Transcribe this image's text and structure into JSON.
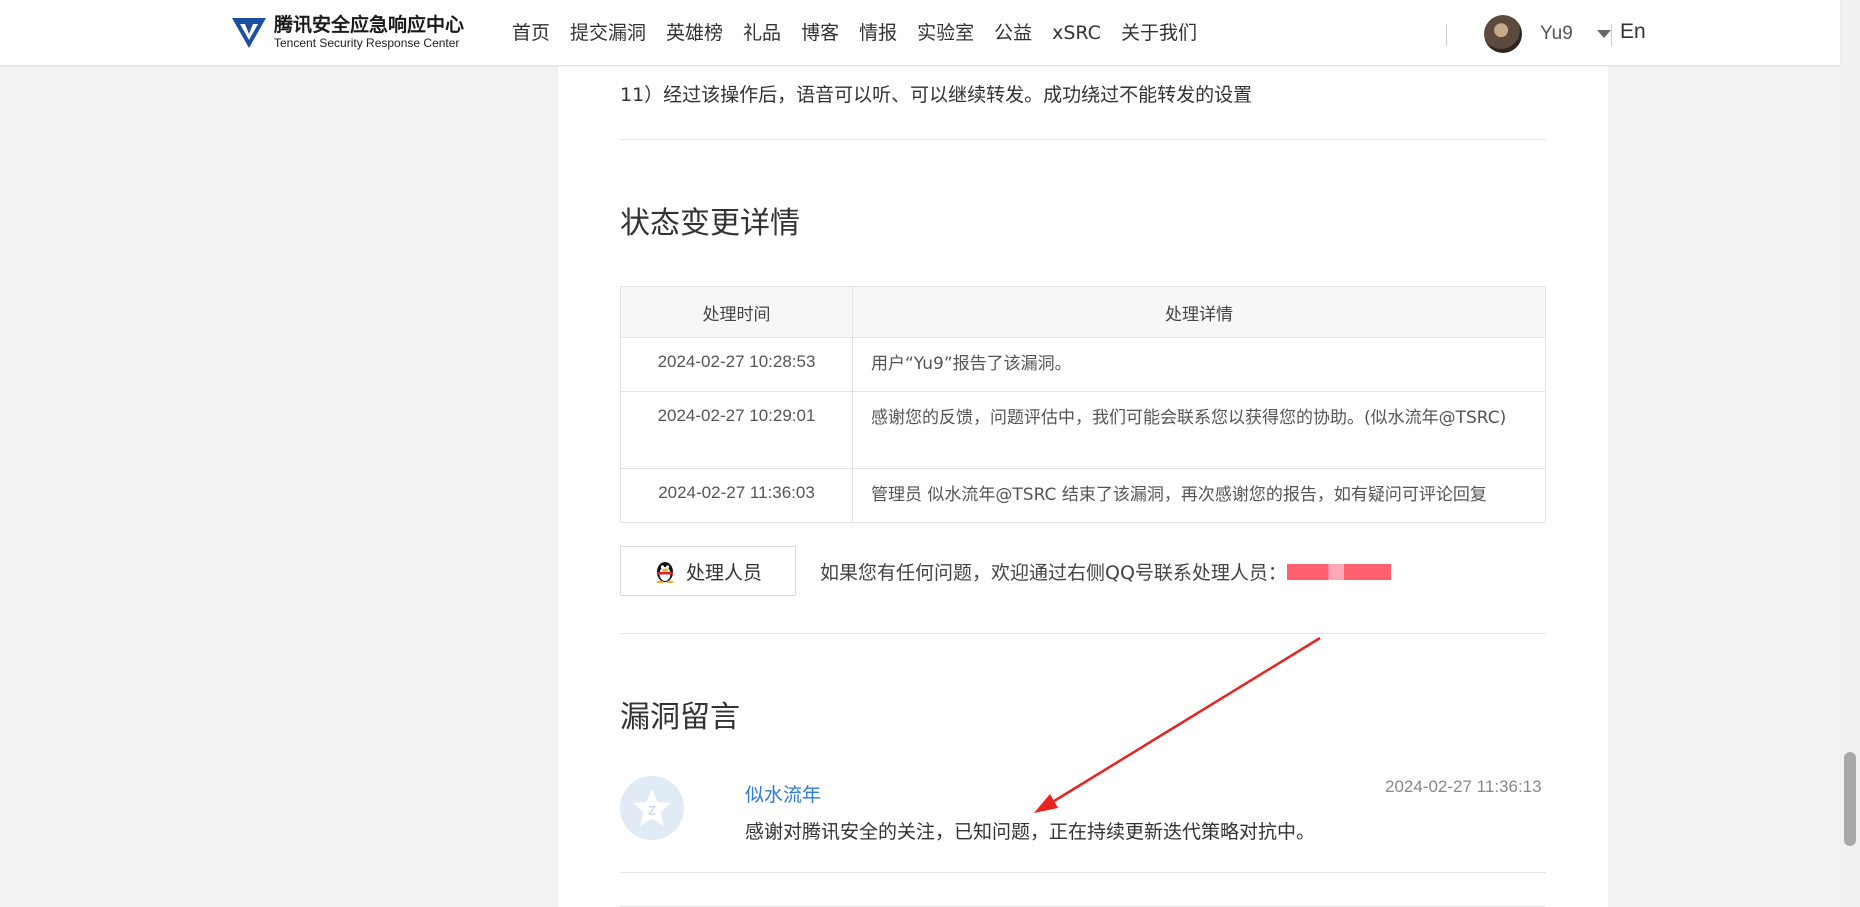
{
  "header": {
    "logo_cn": "腾讯安全应急响应中心",
    "logo_en": "Tencent Security Response Center",
    "nav": [
      "首页",
      "提交漏洞",
      "英雄榜",
      "礼品",
      "博客",
      "情报",
      "实验室",
      "公益",
      "xSRC",
      "关于我们"
    ],
    "user_name": "Yu9",
    "lang": "En"
  },
  "content": {
    "intro": "11）经过该操作后，语音可以听、可以继续转发。成功绕过不能转发的设置",
    "status_title": "状态变更详情",
    "table": {
      "headers": [
        "处理时间",
        "处理详情"
      ],
      "rows": [
        {
          "time": "2024-02-27 10:28:53",
          "detail": "用户“Yu9”报告了该漏洞。"
        },
        {
          "time": "2024-02-27 10:29:01",
          "detail": "感谢您的反馈，问题评估中，我们可能会联系您以获得您的协助。(似水流年@TSRC)"
        },
        {
          "time": "2024-02-27 11:36:03",
          "detail": "管理员 似水流年@TSRC 结束了该漏洞，再次感谢您的报告，如有疑问可评论回复"
        }
      ]
    },
    "handler_button": "处理人员",
    "contact_text": "如果您有任何问题，欢迎通过右侧QQ号联系处理人员：",
    "comments_title": "漏洞留言",
    "comment": {
      "author": "似水流年",
      "time": "2024-02-27 11:36:13",
      "text": "感谢对腾讯安全的关注，已知问题，正在持续更新迭代策略对抗中。"
    }
  },
  "colors": {
    "link": "#2a7bd8",
    "annotation_arrow": "#e8221c"
  }
}
